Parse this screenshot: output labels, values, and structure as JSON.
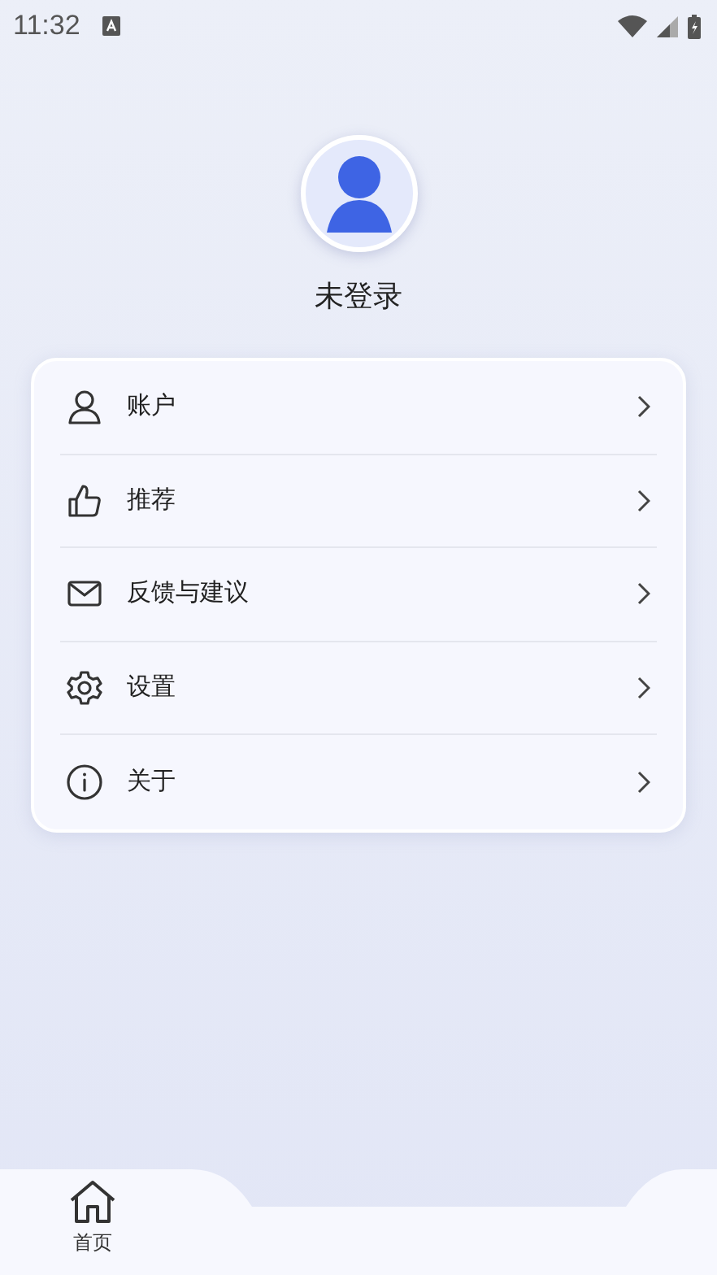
{
  "status_bar": {
    "time": "11:32"
  },
  "profile": {
    "name": "未登录"
  },
  "menu": [
    {
      "kind": "account",
      "label": "账户"
    },
    {
      "kind": "recommend",
      "label": "推荐"
    },
    {
      "kind": "feedback",
      "label": "反馈与建议"
    },
    {
      "kind": "settings",
      "label": "设置"
    },
    {
      "kind": "about",
      "label": "关于"
    }
  ],
  "bottom_nav": [
    {
      "label": "首页",
      "selected": true
    }
  ]
}
